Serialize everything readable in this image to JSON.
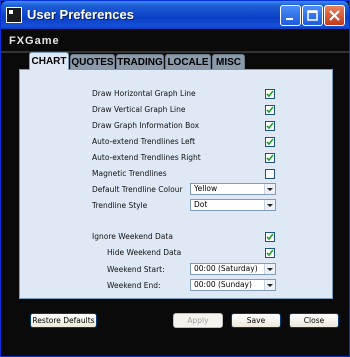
{
  "window": {
    "title": "User Preferences",
    "brand": "FXGame"
  },
  "tabs": [
    {
      "label": "CHART",
      "active": true
    },
    {
      "label": "QUOTES",
      "active": false
    },
    {
      "label": "TRADING",
      "active": false
    },
    {
      "label": "LOCALE",
      "active": false
    },
    {
      "label": "MISC",
      "active": false
    }
  ],
  "chart": {
    "draw_horizontal": {
      "label": "Draw Horizontal Graph Line",
      "checked": true
    },
    "draw_vertical": {
      "label": "Draw Vertical Graph Line",
      "checked": true
    },
    "draw_info_box": {
      "label": "Draw Graph Information Box",
      "checked": true
    },
    "extend_left": {
      "label": "Auto-extend Trendlines Left",
      "checked": true
    },
    "extend_right": {
      "label": "Auto-extend Trendlines Right",
      "checked": true
    },
    "magnetic": {
      "label": "Magnetic Trendlines",
      "checked": false
    },
    "trend_colour": {
      "label": "Default Trendline Colour",
      "value": "Yellow"
    },
    "trend_style": {
      "label": "Trendline Style",
      "value": "Dot"
    },
    "ignore_weekend": {
      "label": "Ignore Weekend Data",
      "checked": true
    },
    "hide_weekend": {
      "label": "Hide Weekend Data",
      "checked": true
    },
    "weekend_start": {
      "label": "Weekend Start:",
      "value": "00:00 (Saturday)"
    },
    "weekend_end": {
      "label": "Weekend End:",
      "value": "00:00 (Sunday)"
    }
  },
  "buttons": {
    "restore": "Restore Defaults",
    "apply": "Apply",
    "save": "Save",
    "close": "Close"
  },
  "colors": {
    "titlebar": "#0a3fc6",
    "panel": "#dfe9f5",
    "background": "#0a0a0a"
  }
}
